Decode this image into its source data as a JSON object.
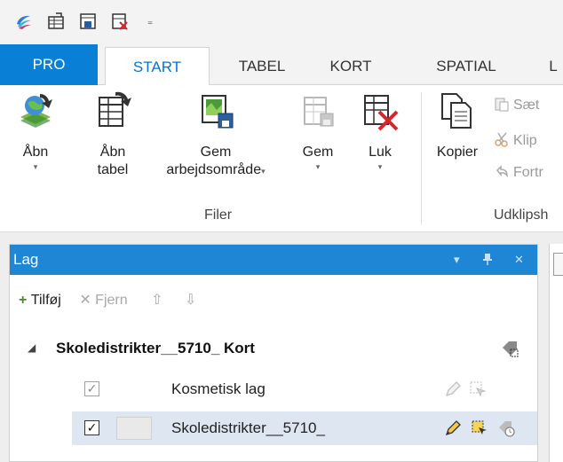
{
  "tabs": {
    "pro": "PRO",
    "start": "START",
    "tabel": "TABEL",
    "kort": "KORT",
    "spatial": "SPATIAL",
    "l": "L"
  },
  "ribbon": {
    "abn": "Åbn",
    "abn_tabel_line1": "Åbn",
    "abn_tabel_line2": "tabel",
    "gem_arbejdsomraade_line1": "Gem",
    "gem_arbejdsomraade_line2": "arbejdsområde",
    "gem": "Gem",
    "luk": "Luk",
    "filer_group": "Filer",
    "kopier": "Kopier",
    "saet": "Sæt",
    "klip": "Klip",
    "fortryd": "Fortr",
    "udklipsholder_group": "Udklipsh",
    "dropdown_arrow": "▾"
  },
  "lag_pane": {
    "title": "Lag",
    "pin": "▾",
    "dock": "🖈",
    "close": "✕",
    "add": "Tilføj",
    "remove": "Fjern",
    "map_name": "Skoledistrikter__5710_ Kort",
    "expander": "◢",
    "layers": [
      {
        "label": "Kosmetisk lag",
        "checked": true,
        "selected": false
      },
      {
        "label": "Skoledistrikter__5710_",
        "checked": true,
        "selected": true
      }
    ],
    "check_mark": "✓"
  },
  "colors": {
    "accent_blue": "#1f86d6",
    "pro_tab": "#0a7fd6",
    "selection": "#dde6f1"
  }
}
